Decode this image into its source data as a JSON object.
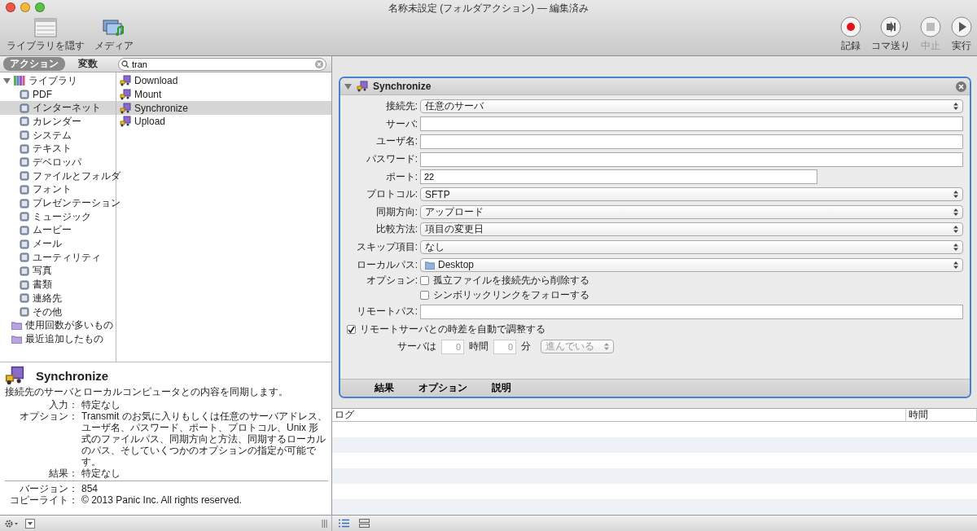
{
  "window": {
    "title": "名称未設定 (フォルダアクション) — 編集済み"
  },
  "toolbar": {
    "left": [
      {
        "label": "ライブラリを隠す",
        "kind": "library"
      },
      {
        "label": "メディア",
        "kind": "media"
      }
    ],
    "right": [
      {
        "label": "記録",
        "kind": "record",
        "disabled": false
      },
      {
        "label": "コマ送り",
        "kind": "step",
        "disabled": false
      },
      {
        "label": "中止",
        "kind": "stop",
        "disabled": true
      },
      {
        "label": "実行",
        "kind": "run",
        "disabled": false
      }
    ]
  },
  "library_tabs": [
    {
      "label": "アクション",
      "selected": true
    },
    {
      "label": "変数",
      "selected": false
    }
  ],
  "search": {
    "value": "tran"
  },
  "library": {
    "label": "ライブラリ",
    "expanded": true,
    "children": [
      {
        "label": "PDF",
        "selected": false
      },
      {
        "label": "インターネット",
        "selected": true
      },
      {
        "label": "カレンダー",
        "selected": false
      },
      {
        "label": "システム",
        "selected": false
      },
      {
        "label": "テキスト",
        "selected": false
      },
      {
        "label": "デベロッパ",
        "selected": false
      },
      {
        "label": "ファイルとフォルダ",
        "selected": false
      },
      {
        "label": "フォント",
        "selected": false
      },
      {
        "label": "プレゼンテーション",
        "selected": false
      },
      {
        "label": "ミュージック",
        "selected": false
      },
      {
        "label": "ムービー",
        "selected": false
      },
      {
        "label": "メール",
        "selected": false
      },
      {
        "label": "ユーティリティ",
        "selected": false
      },
      {
        "label": "写真",
        "selected": false
      },
      {
        "label": "書類",
        "selected": false
      },
      {
        "label": "連絡先",
        "selected": false
      },
      {
        "label": "その他",
        "selected": false
      }
    ]
  },
  "smart_groups": [
    {
      "label": "使用回数が多いもの",
      "selected": false
    },
    {
      "label": "最近追加したもの",
      "selected": false
    }
  ],
  "actions": [
    {
      "label": "Download",
      "selected": false
    },
    {
      "label": "Mount",
      "selected": false
    },
    {
      "label": "Synchronize",
      "selected": true
    },
    {
      "label": "Upload",
      "selected": false
    }
  ],
  "description": {
    "title": "Synchronize",
    "summary": "接続先のサーバとローカルコンピュータとの内容を同期します。",
    "fields": [
      {
        "label": "入力：",
        "value": "特定なし"
      },
      {
        "label": "オプション：",
        "value": "Transmit のお気に入りもしくは任意のサーバアドレス、ユーザ名、パスワード、ポート、プロトコル、Unix 形式のファイルパス、同期方向と方法、同期するローカルのパス、そしていくつかのオプションの指定が可能です。"
      },
      {
        "label": "結果：",
        "value": "特定なし"
      }
    ],
    "meta": [
      {
        "label": "バージョン：",
        "value": "854"
      },
      {
        "label": "コピーライト：",
        "value": "© 2013 Panic Inc. All rights reserved."
      }
    ]
  },
  "action_card": {
    "title": "Synchronize",
    "expanded": true,
    "fields": [
      {
        "label": "接続先:",
        "kind": "select",
        "value": "任意のサーバ"
      },
      {
        "label": "サーバ:",
        "kind": "text"
      },
      {
        "label": "ユーザ名:",
        "kind": "text"
      },
      {
        "label": "パスワード:",
        "kind": "text"
      },
      {
        "label": "ポート:",
        "kind": "short_text",
        "value": "22"
      },
      {
        "label": "プロトコル:",
        "kind": "select",
        "value": "SFTP"
      },
      {
        "label": "同期方向:",
        "kind": "select",
        "value": "アップロード"
      },
      {
        "label": "比較方法:",
        "kind": "select",
        "value": "項目の変更日"
      },
      {
        "label": "スキップ項目:",
        "kind": "select",
        "value": "なし"
      },
      {
        "label": "ローカルパス:",
        "kind": "folder_select",
        "value": "Desktop"
      }
    ],
    "options": {
      "label": "オプション:",
      "checkboxes": [
        {
          "label": "孤立ファイルを接続先から削除する",
          "checked": false
        },
        {
          "label": "シンボリックリンクをフォローする",
          "checked": false
        }
      ]
    },
    "remote_path": {
      "label": "リモートパス:"
    },
    "auto_adjust": {
      "label": "リモートサーバとの時差を自動で調整する",
      "checked": true
    },
    "offset": {
      "prefix": "サーバは",
      "hours": "0",
      "hours_unit": "時間",
      "minutes": "0",
      "minutes_unit": "分",
      "direction": "進んでいる",
      "disabled": true
    },
    "footer_tabs": [
      "結果",
      "オプション",
      "説明"
    ]
  },
  "log": {
    "columns": [
      "ログ",
      "時間"
    ]
  }
}
